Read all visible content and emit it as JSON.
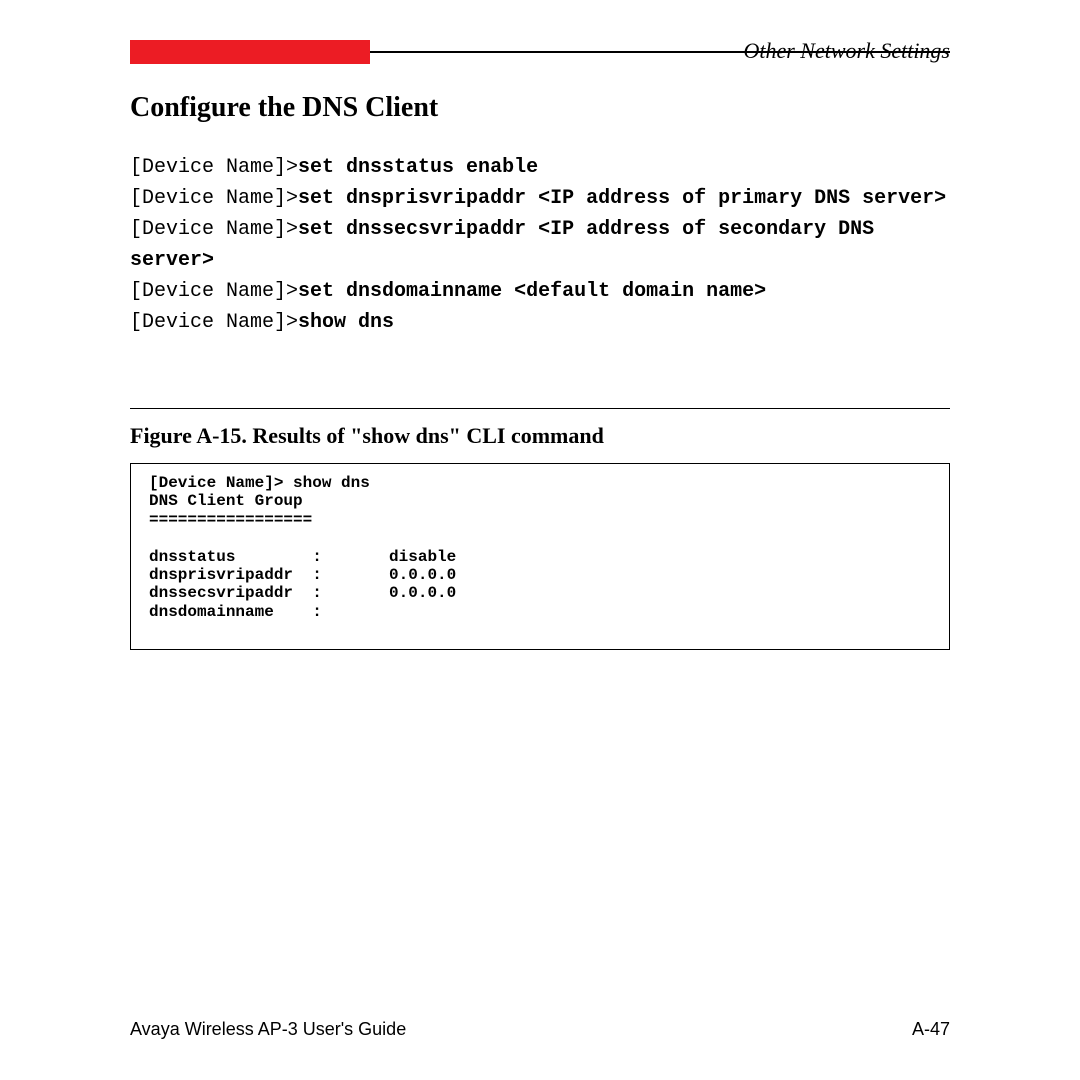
{
  "header": {
    "breadcrumb": "Other Network Settings"
  },
  "section": {
    "title": "Configure the DNS Client"
  },
  "commands": [
    {
      "prompt": "[Device Name]>",
      "bold": "set dnsstatus enable"
    },
    {
      "prompt": "[Device Name]>",
      "bold": "set dnsprisvripaddr <IP address of primary DNS server>"
    },
    {
      "prompt": "[Device Name]>",
      "bold": "set dnssecsvripaddr <IP address of secondary DNS server>"
    },
    {
      "prompt": "[Device Name]>",
      "bold": "set dnsdomainname <default domain name>"
    },
    {
      "prompt": "[Device Name]>",
      "bold": "show dns"
    }
  ],
  "figure": {
    "caption": "Figure A-15.   Results of \"show dns\" CLI command"
  },
  "output": {
    "lines": [
      "[Device Name]> show dns",
      "DNS Client Group",
      "=================",
      "",
      "dnsstatus        :       disable",
      "dnsprisvripaddr  :       0.0.0.0",
      "dnssecsvripaddr  :       0.0.0.0",
      "dnsdomainname    :"
    ]
  },
  "footer": {
    "left": "Avaya Wireless AP-3 User's Guide",
    "right": "A-47"
  }
}
